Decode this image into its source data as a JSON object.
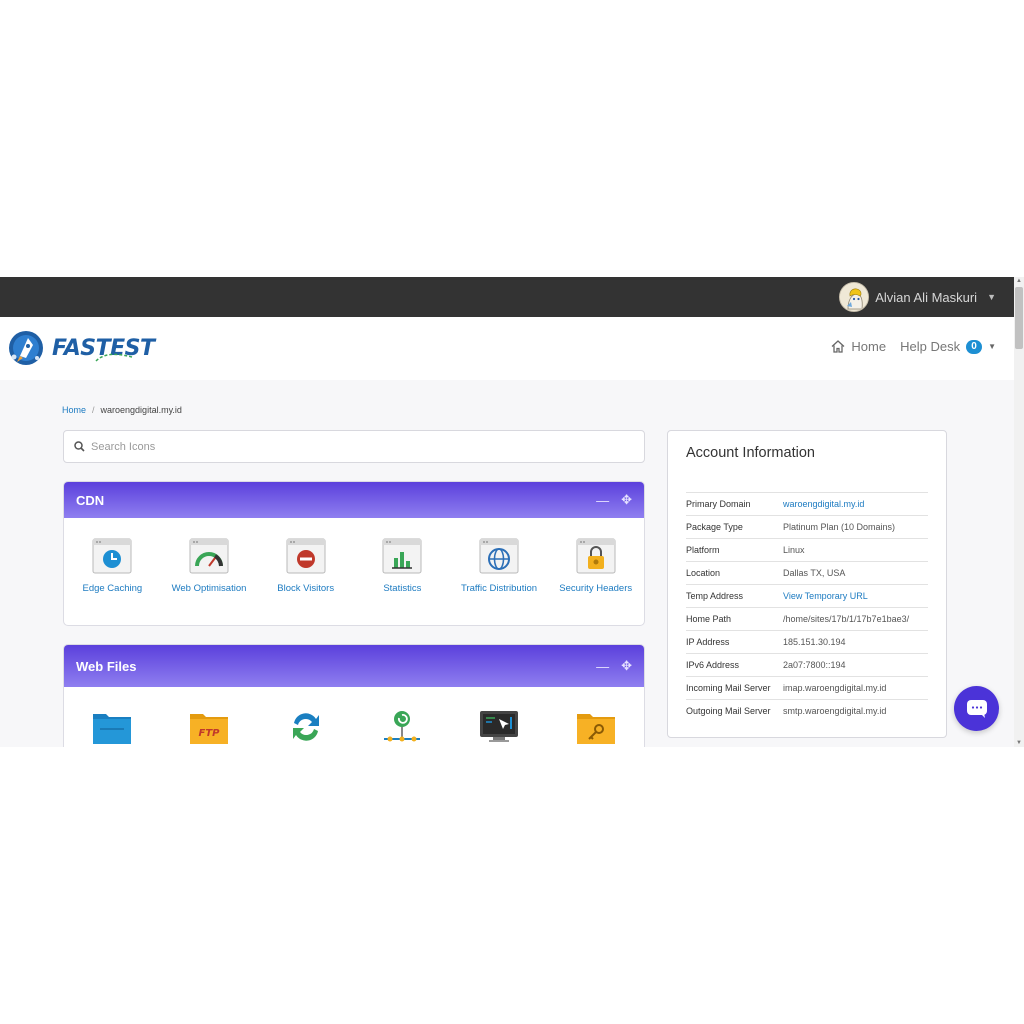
{
  "topbar": {
    "user_name": "Alvian Ali Maskuri"
  },
  "header": {
    "logo_text": "FASTEST",
    "nav": {
      "home": "Home",
      "help_desk": "Help Desk",
      "help_desk_count": "0"
    }
  },
  "breadcrumb": {
    "home": "Home",
    "separator": "/",
    "current": "waroengdigital.my.id"
  },
  "search": {
    "placeholder": "Search Icons"
  },
  "panels": [
    {
      "title": "CDN",
      "tools": [
        {
          "label": "Edge Caching",
          "icon": "clock-icon"
        },
        {
          "label": "Web Optimisation",
          "icon": "gauge-icon"
        },
        {
          "label": "Block Visitors",
          "icon": "block-icon"
        },
        {
          "label": "Statistics",
          "icon": "bar-chart-icon"
        },
        {
          "label": "Traffic Distribution",
          "icon": "globe-icon"
        },
        {
          "label": "Security Headers",
          "icon": "lock-icon"
        }
      ]
    },
    {
      "title": "Web Files",
      "tools": [
        {
          "label": "",
          "icon": "folder-icon"
        },
        {
          "label": "",
          "icon": "ftp-folder-icon"
        },
        {
          "label": "",
          "icon": "sync-icon"
        },
        {
          "label": "",
          "icon": "network-icon"
        },
        {
          "label": "",
          "icon": "terminal-icon"
        },
        {
          "label": "",
          "icon": "key-folder-icon"
        }
      ]
    }
  ],
  "account": {
    "title": "Account Information",
    "rows": [
      {
        "label": "Primary Domain",
        "value": "waroengdigital.my.id"
      },
      {
        "label": "Package Type",
        "value": "Platinum Plan (10 Domains)"
      },
      {
        "label": "Platform",
        "value": "Linux"
      },
      {
        "label": "Location",
        "value": "Dallas TX, USA"
      },
      {
        "label": "Temp Address",
        "value": "View Temporary URL"
      },
      {
        "label": "Home Path",
        "value": "/home/sites/17b/1/17b7e1bae3/"
      },
      {
        "label": "IP Address",
        "value": "185.151.30.194"
      },
      {
        "label": "IPv6 Address",
        "value": "2a07:7800::194"
      },
      {
        "label": "Incoming Mail Server",
        "value": "imap.waroengdigital.my.id"
      },
      {
        "label": "Outgoing Mail Server",
        "value": "smtp.waroengdigital.my.id"
      }
    ]
  },
  "colors": {
    "accent": "#5b40dc",
    "link": "#1d7bc1",
    "topbar": "#333333",
    "badge": "#1d8fd3"
  }
}
